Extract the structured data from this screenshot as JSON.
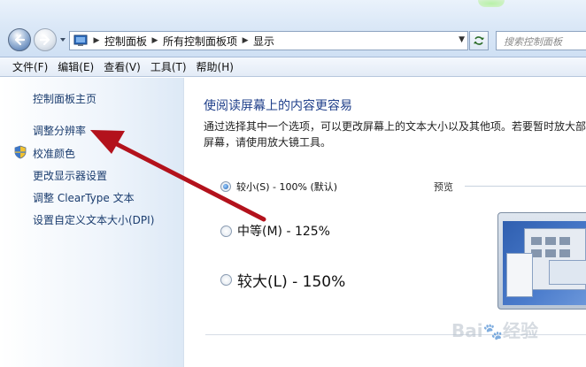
{
  "address_bar": {
    "crumbs": [
      "控制面板",
      "所有控制面板项",
      "显示"
    ]
  },
  "search": {
    "placeholder": "搜索控制面板"
  },
  "menu": [
    "文件(F)",
    "编辑(E)",
    "查看(V)",
    "工具(T)",
    "帮助(H)"
  ],
  "sidebar": {
    "items": [
      {
        "label": "控制面板主页",
        "icon": null
      },
      {
        "label": "调整分辨率",
        "icon": null
      },
      {
        "label": "校准颜色",
        "icon": "shield-icon"
      },
      {
        "label": "更改显示器设置",
        "icon": null
      },
      {
        "label": "调整 ClearType 文本",
        "icon": null
      },
      {
        "label": "设置自定义文本大小(DPI)",
        "icon": null
      }
    ]
  },
  "main": {
    "title": "使阅读屏幕上的内容更容易",
    "description": "通过选择其中一个选项，可以更改屏幕上的文本大小以及其他项。若要暂时放大部分屏幕，请使用放大镜工具。",
    "options": [
      {
        "label": "较小(S) - 100% (默认)",
        "selected": true
      },
      {
        "label": "中等(M) - 125%",
        "selected": false
      },
      {
        "label": "较大(L) - 150%",
        "selected": false
      }
    ],
    "preview_label": "预览"
  },
  "annotation": {
    "color": "#b3121c"
  },
  "watermark": {
    "brand": "Bai",
    "suffix": "经验"
  },
  "colors": {
    "link": "#1a3c6e",
    "title": "#1f3f8a",
    "chrome": "#dbe8f7"
  }
}
